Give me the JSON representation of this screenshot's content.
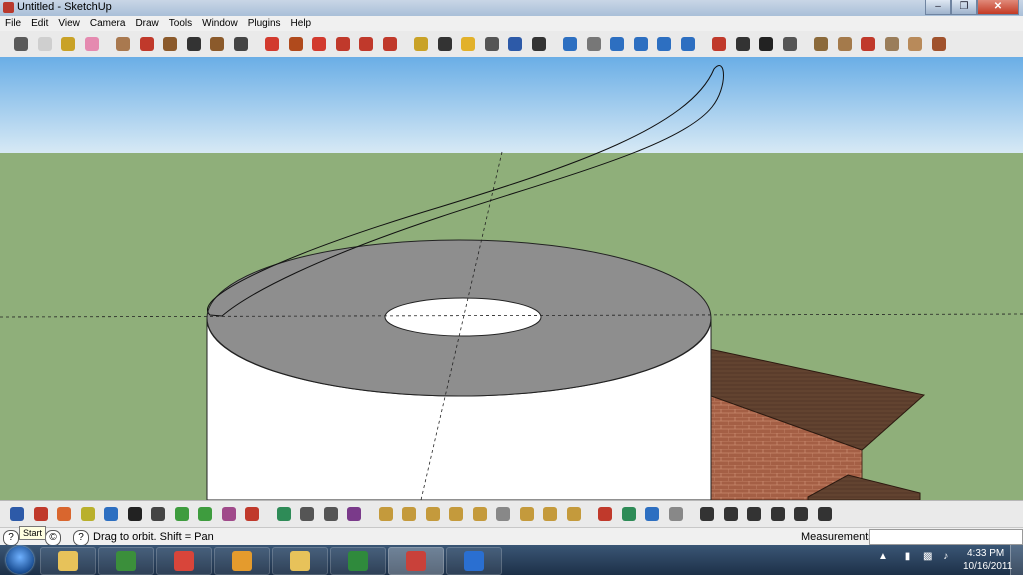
{
  "window": {
    "title": "Untitled - SketchUp"
  },
  "menu": [
    "File",
    "Edit",
    "View",
    "Camera",
    "Draw",
    "Tools",
    "Window",
    "Plugins",
    "Help"
  ],
  "toolbar_icons": [
    {
      "name": "select-icon",
      "color": "#5a5a5a"
    },
    {
      "name": "make-component-icon",
      "color": "#cfcfcf"
    },
    {
      "name": "paint-bucket-icon",
      "color": "#c9a227"
    },
    {
      "name": "eraser-icon",
      "color": "#e58ab0"
    },
    {
      "name": "rectangle-icon",
      "color": "#a9794f"
    },
    {
      "name": "line-icon",
      "color": "#c0392b"
    },
    {
      "name": "circle-icon",
      "color": "#8b5a2b"
    },
    {
      "name": "arc-icon",
      "color": "#333333"
    },
    {
      "name": "polygon-icon",
      "color": "#8b5a2b"
    },
    {
      "name": "freehand-icon",
      "color": "#444444"
    },
    {
      "name": "move-icon",
      "color": "#d23a2e"
    },
    {
      "name": "push-pull-icon",
      "color": "#b04a1c"
    },
    {
      "name": "rotate-icon",
      "color": "#d23a2e"
    },
    {
      "name": "follow-me-icon",
      "color": "#c0392b"
    },
    {
      "name": "scale-icon",
      "color": "#c0392b"
    },
    {
      "name": "offset-icon",
      "color": "#c0392b"
    },
    {
      "name": "tape-measure-icon",
      "color": "#c9a227"
    },
    {
      "name": "dimension-icon",
      "color": "#333333"
    },
    {
      "name": "protractor-icon",
      "color": "#e2b12a"
    },
    {
      "name": "text-icon",
      "color": "#555555"
    },
    {
      "name": "axes-icon",
      "color": "#2d5aa8"
    },
    {
      "name": "3d-text-icon",
      "color": "#333333"
    },
    {
      "name": "orbit-icon",
      "color": "#2d6fc1"
    },
    {
      "name": "pan-icon",
      "color": "#777777"
    },
    {
      "name": "zoom-icon",
      "color": "#2d6fc1"
    },
    {
      "name": "zoom-window-icon",
      "color": "#2d6fc1"
    },
    {
      "name": "zoom-extents-icon",
      "color": "#2d6fc1"
    },
    {
      "name": "previous-view-icon",
      "color": "#2d6fc1"
    },
    {
      "name": "position-camera-icon",
      "color": "#c0392b"
    },
    {
      "name": "look-around-icon",
      "color": "#333333"
    },
    {
      "name": "walk-icon",
      "color": "#222222"
    },
    {
      "name": "section-plane-icon",
      "color": "#555555"
    },
    {
      "name": "get-models-icon",
      "color": "#8b6a3b"
    },
    {
      "name": "share-model-icon",
      "color": "#a47a4b"
    },
    {
      "name": "share-component-icon",
      "color": "#c0392b"
    },
    {
      "name": "photo-textures-icon",
      "color": "#9a7d5a"
    },
    {
      "name": "preview-google-earth-icon",
      "color": "#b88a5a"
    },
    {
      "name": "toggle-terrain-icon",
      "color": "#a0522d"
    }
  ],
  "bottom_toolbar_icons": [
    {
      "name": "orbit-icon",
      "color": "#2d5aa8"
    },
    {
      "name": "line-icon",
      "color": "#c0392b"
    },
    {
      "name": "offset-icon",
      "color": "#d9662e"
    },
    {
      "name": "pencil-icon",
      "color": "#b9b02c"
    },
    {
      "name": "rotate-icon",
      "color": "#2d6fc1"
    },
    {
      "name": "hand-icon",
      "color": "#222222"
    },
    {
      "name": "sphere-icon",
      "color": "#444444"
    },
    {
      "name": "green-shape-icon",
      "color": "#3e9c3e"
    },
    {
      "name": "spring-icon",
      "color": "#3e9c3e"
    },
    {
      "name": "magic-wand-icon",
      "color": "#a04a8a"
    },
    {
      "name": "scissors-icon",
      "color": "#c0392b"
    },
    {
      "name": "play-icon",
      "color": "#2e8b57"
    },
    {
      "name": "rewind-icon",
      "color": "#555555"
    },
    {
      "name": "pause-icon",
      "color": "#555555"
    },
    {
      "name": "cubes-icon",
      "color": "#7a3a8a"
    },
    {
      "name": "box-icon",
      "color": "#c49a3c"
    },
    {
      "name": "dome-icon",
      "color": "#c49a3c"
    },
    {
      "name": "cylinder-icon",
      "color": "#c49a3c"
    },
    {
      "name": "cone-icon",
      "color": "#c49a3c"
    },
    {
      "name": "tube-icon",
      "color": "#c49a3c"
    },
    {
      "name": "plate-icon",
      "color": "#888888"
    },
    {
      "name": "torus-icon",
      "color": "#c49a3c"
    },
    {
      "name": "helix-icon",
      "color": "#c49a3c"
    },
    {
      "name": "dome-arrow-icon",
      "color": "#c49a3c"
    },
    {
      "name": "record-icon",
      "color": "#c0392b"
    },
    {
      "name": "extrude-icon",
      "color": "#2e8b57"
    },
    {
      "name": "k-icon",
      "color": "#2d6fc1"
    },
    {
      "name": "double-chevron-icon",
      "color": "#888888"
    },
    {
      "name": "house-view-1-icon",
      "color": "#333333"
    },
    {
      "name": "house-view-2-icon",
      "color": "#333333"
    },
    {
      "name": "house-view-3-icon",
      "color": "#333333"
    },
    {
      "name": "house-view-4-icon",
      "color": "#333333"
    },
    {
      "name": "house-view-5-icon",
      "color": "#333333"
    },
    {
      "name": "house-view-6-icon",
      "color": "#333333"
    }
  ],
  "status": {
    "tooltip": "Start",
    "hint": "Drag to orbit.  Shift = Pan",
    "measurements_label": "Measurements",
    "measurements_value": ""
  },
  "scene": {
    "sky_top": "#6aaee6",
    "sky_bottom": "#d7e9f5",
    "ground": "#8faf7a",
    "cylinder_top": "#8e8e8e",
    "cylinder_side": "#ffffff",
    "brick": "#a45f45",
    "roof": "#5b3d2c"
  },
  "taskbar": {
    "apps": [
      {
        "name": "file-explorer-taskbar-icon",
        "color": "#e7c25a"
      },
      {
        "name": "media-player-taskbar-icon",
        "color": "#3b8f3b"
      },
      {
        "name": "chrome-taskbar-icon",
        "color": "#d8453a"
      },
      {
        "name": "outlook-taskbar-icon",
        "color": "#e49b2d"
      },
      {
        "name": "folder-taskbar-icon",
        "color": "#e7c25a"
      },
      {
        "name": "excel-taskbar-icon",
        "color": "#2f8a3c"
      },
      {
        "name": "sketchup-taskbar-icon",
        "color": "#c9413a"
      },
      {
        "name": "google-earth-taskbar-icon",
        "color": "#2a6fd1"
      }
    ],
    "time": "4:33 PM",
    "date": "10/16/2011"
  }
}
